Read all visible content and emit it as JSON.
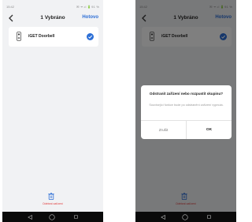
{
  "left_screen": {
    "status_bar": {
      "time": "15:42",
      "icons": "✉ ᯤ.ıl 🔋91 %"
    },
    "header": {
      "title": "1 Vybráno",
      "done_label": "Hotovo"
    },
    "device": {
      "name": "iGET Doorbell",
      "selected": true
    },
    "footer": {
      "delete_label": "Odebrat zařízení"
    }
  },
  "right_screen": {
    "status_bar": {
      "time": "15:42",
      "icons": "✉ ᯤ.ıl 🔋91 %"
    },
    "header": {
      "title": "1 Vybráno",
      "done_label": "Hotovo"
    },
    "device": {
      "name": "iGET Doorbell",
      "selected": true
    },
    "footer": {
      "delete_label": "Odebrat zařízení"
    },
    "dialog": {
      "title": "Odstranit zařízení nebo rozpustit skupinu?",
      "message": "Související funkce bude po odstranění zařízení vypnuta.",
      "cancel_label": "Zrušit",
      "ok_label": "OK"
    }
  },
  "colors": {
    "accent": "#2d6fd6",
    "danger": "#e04040",
    "screen_bg": "#f1f2f4",
    "nav_bar": "#0a0a0a"
  },
  "icons": [
    "back-chevron-icon",
    "doorbell-icon",
    "check-circle-icon",
    "trash-icon",
    "nav-back-icon",
    "nav-home-icon",
    "nav-recent-icon"
  ]
}
